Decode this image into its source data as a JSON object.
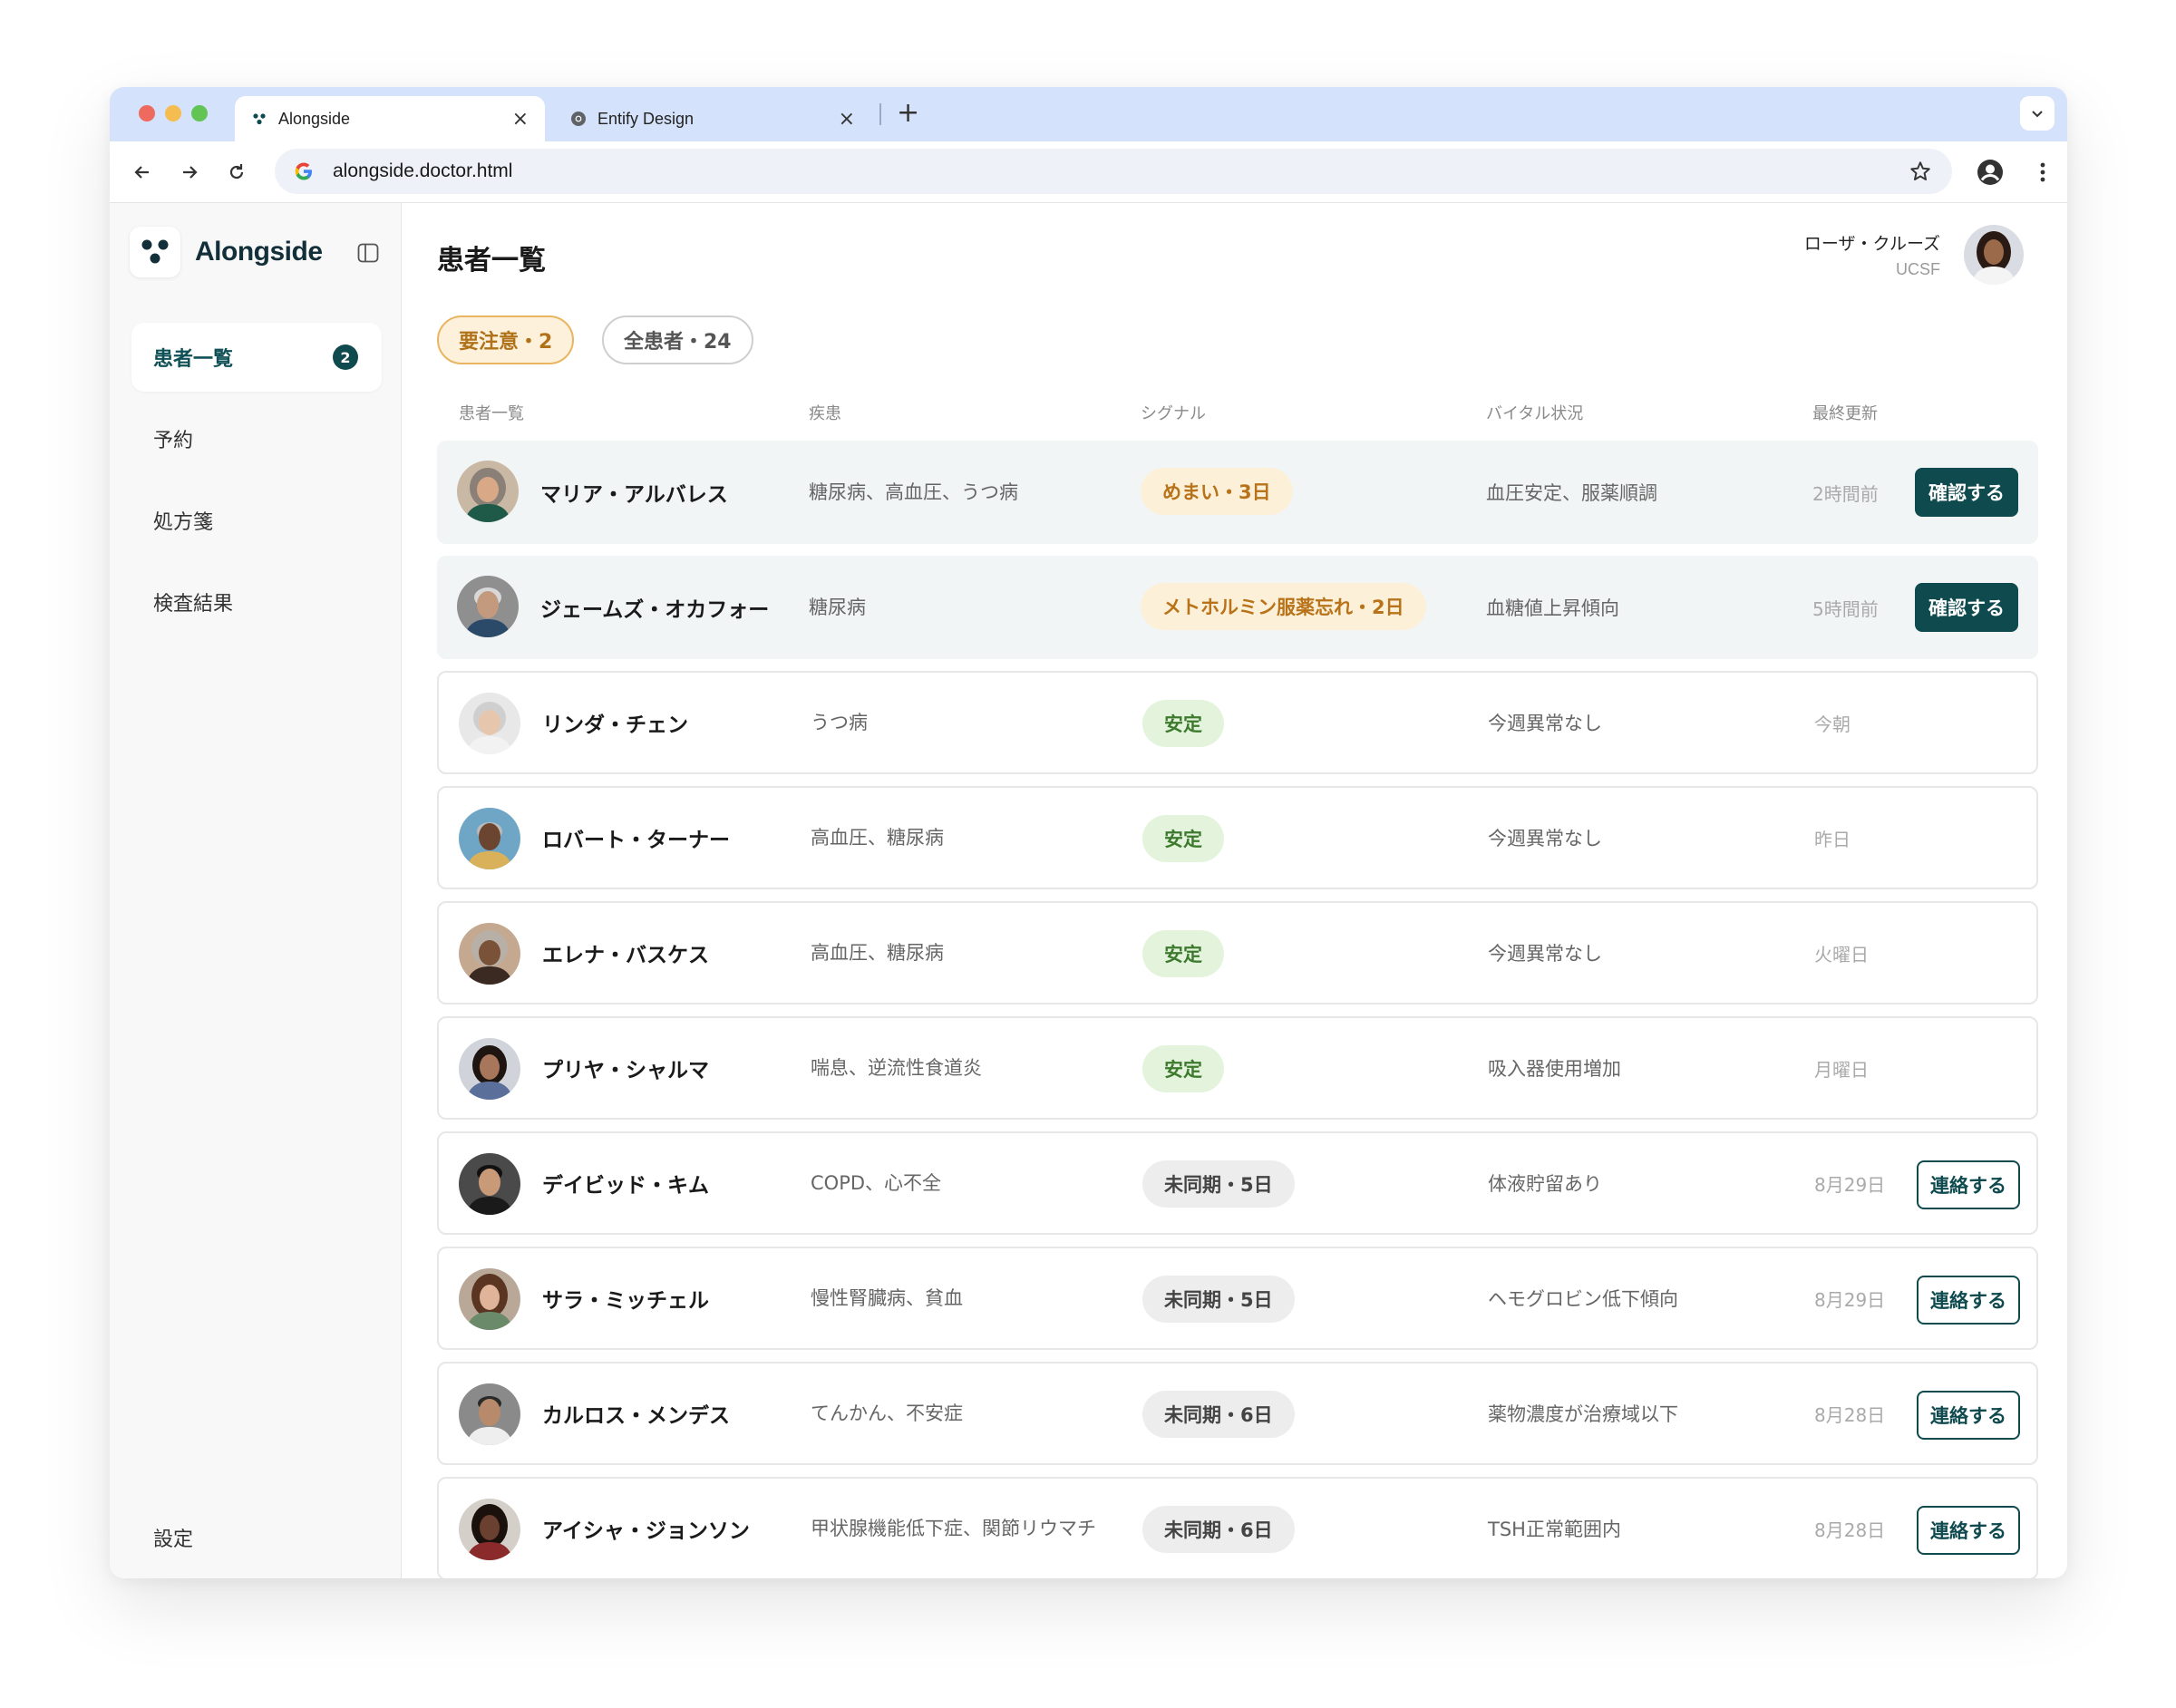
{
  "browser": {
    "tabs": [
      {
        "label": "Alongside"
      },
      {
        "label": "Entify Design"
      }
    ],
    "url": "alongside.doctor.html"
  },
  "sidebar": {
    "brand": "Alongside",
    "items": [
      {
        "label": "患者一覧",
        "badge": "2"
      },
      {
        "label": "予約"
      },
      {
        "label": "処方箋"
      },
      {
        "label": "検査結果"
      }
    ],
    "settings": "設定"
  },
  "header": {
    "title": "患者一覧",
    "user_name": "ローザ・クルーズ",
    "user_org": "UCSF"
  },
  "filters": {
    "attention": "要注意・2",
    "all": "全患者・24"
  },
  "columns": [
    "患者一覧",
    "疾患",
    "シグナル",
    "バイタル状況",
    "最終更新"
  ],
  "patients": [
    {
      "name": "マリア・アルバレス",
      "conditions": "糖尿病、高血圧、うつ病",
      "signal": "めまい・3日",
      "vitals": "血圧安定、服薬順調",
      "updated": "2時間前",
      "action": "確認する"
    },
    {
      "name": "ジェームズ・オカフォー",
      "conditions": "糖尿病",
      "signal": "メトホルミン服薬忘れ・2日",
      "vitals": "血糖値上昇傾向",
      "updated": "5時間前",
      "action": "確認する"
    },
    {
      "name": "リンダ・チェン",
      "conditions": "うつ病",
      "signal": "安定",
      "vitals": "今週異常なし",
      "updated": "今朝"
    },
    {
      "name": "ロバート・ターナー",
      "conditions": "高血圧、糖尿病",
      "signal": "安定",
      "vitals": "今週異常なし",
      "updated": "昨日"
    },
    {
      "name": "エレナ・バスケス",
      "conditions": "高血圧、糖尿病",
      "signal": "安定",
      "vitals": "今週異常なし",
      "updated": "火曜日"
    },
    {
      "name": "プリヤ・シャルマ",
      "conditions": "喘息、逆流性食道炎",
      "signal": "安定",
      "vitals": "吸入器使用増加",
      "updated": "月曜日"
    },
    {
      "name": "デイビッド・キム",
      "conditions": "COPD、心不全",
      "signal": "未同期・5日",
      "vitals": "体液貯留あり",
      "updated": "8月29日",
      "action": "連絡する"
    },
    {
      "name": "サラ・ミッチェル",
      "conditions": "慢性腎臓病、貧血",
      "signal": "未同期・5日",
      "vitals": "ヘモグロビン低下傾向",
      "updated": "8月29日",
      "action": "連絡する"
    },
    {
      "name": "カルロス・メンデス",
      "conditions": "てんかん、不安症",
      "signal": "未同期・6日",
      "vitals": "薬物濃度が治療域以下",
      "updated": "8月28日",
      "action": "連絡する"
    },
    {
      "name": "アイシャ・ジョンソン",
      "conditions": "甲状腺機能低下症、関節リウマチ",
      "signal": "未同期・6日",
      "vitals": "TSH正常範囲内",
      "updated": "8月28日",
      "action": "連絡する"
    }
  ],
  "colors": {
    "accent": "#0f4a4f",
    "warn": "#b8731a",
    "ok": "#3d7a2e"
  }
}
